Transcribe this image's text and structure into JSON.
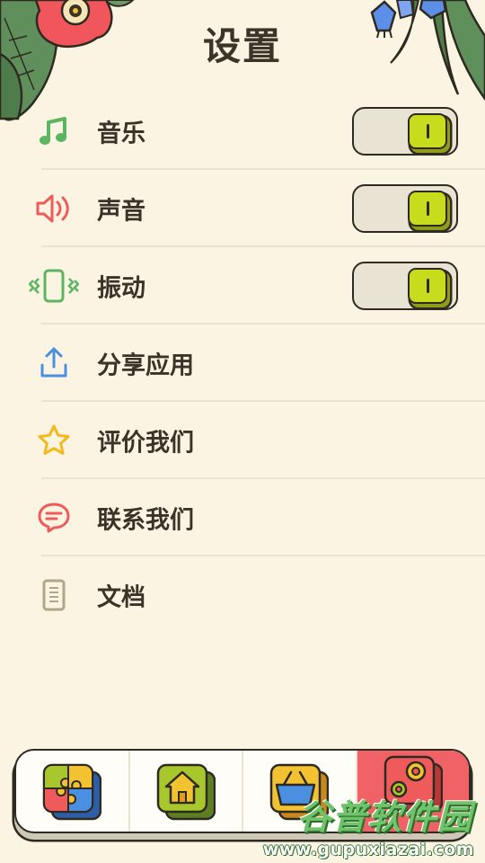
{
  "page": {
    "title": "设置"
  },
  "settings": [
    {
      "label": "音乐",
      "icon": "music-note-icon",
      "color": "#5bb561",
      "toggle": true,
      "on": true
    },
    {
      "label": "声音",
      "icon": "speaker-icon",
      "color": "#ef5a5a",
      "toggle": true,
      "on": true
    },
    {
      "label": "振动",
      "icon": "vibration-icon",
      "color": "#5bb561",
      "toggle": true,
      "on": true
    },
    {
      "label": "分享应用",
      "icon": "share-icon",
      "color": "#4a8fe0",
      "toggle": false
    },
    {
      "label": "评价我们",
      "icon": "star-icon",
      "color": "#f2b81c",
      "toggle": false
    },
    {
      "label": "联系我们",
      "icon": "chat-bubble-icon",
      "color": "#ef5a5a",
      "toggle": false
    },
    {
      "label": "文档",
      "icon": "document-icon",
      "color": "#b3a58a",
      "toggle": false
    }
  ],
  "bottom_nav": {
    "tabs": [
      {
        "icon": "puzzle-icon",
        "active": false
      },
      {
        "icon": "home-icon",
        "active": false
      },
      {
        "icon": "shopping-basket-icon",
        "active": false
      },
      {
        "icon": "settings-gears-icon",
        "active": true
      }
    ],
    "active_color": "#f06265"
  },
  "watermark": {
    "main": "谷普软件园",
    "url": "www.gupuxiazai.com"
  },
  "colors": {
    "background": "#fbf4e2",
    "toggle_knob": "#c8dc1e",
    "text": "#3b3328"
  }
}
